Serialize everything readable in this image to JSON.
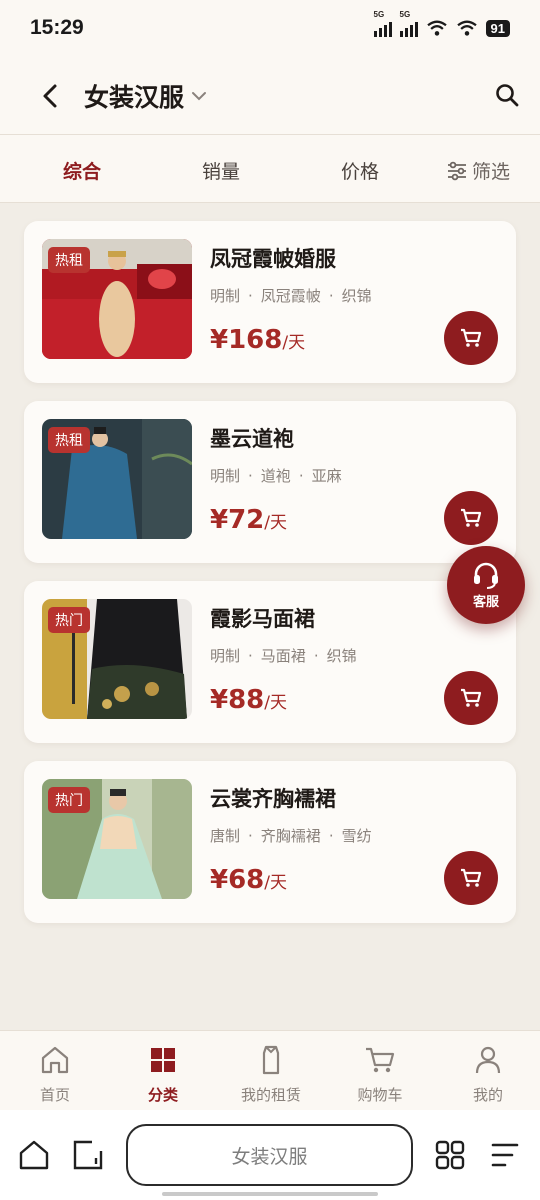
{
  "status_bar": {
    "time": "15:29",
    "signal_labels": [
      "5G",
      "5G"
    ],
    "battery": "91"
  },
  "header": {
    "title": "女装汉服"
  },
  "sort_tabs": [
    {
      "label": "综合",
      "active": true
    },
    {
      "label": "销量",
      "active": false
    },
    {
      "label": "价格",
      "active": false
    },
    {
      "label": "筛选",
      "active": false
    }
  ],
  "products": [
    {
      "name": "凤冠霞帔婚服",
      "badge": "热租",
      "tags": [
        "明制",
        "凤冠霞帔",
        "织锦"
      ],
      "price": "¥168",
      "unit": "/天",
      "image": "red-bridal-dress-photo"
    },
    {
      "name": "墨云道袍",
      "badge": "热租",
      "tags": [
        "明制",
        "道袍",
        "亚麻"
      ],
      "price": "¥72",
      "unit": "/天",
      "image": "blue-taoist-robe-photo"
    },
    {
      "name": "霞影马面裙",
      "badge": "热门",
      "tags": [
        "明制",
        "马面裙",
        "织锦"
      ],
      "price": "¥88",
      "unit": "/天",
      "image": "black-gold-mamian-skirt-photo"
    },
    {
      "name": "云裳齐胸襦裙",
      "badge": "热门",
      "tags": [
        "唐制",
        "齐胸襦裙",
        "雪纺"
      ],
      "price": "¥68",
      "unit": "/天",
      "image": "green-ruqun-dress-photo"
    }
  ],
  "service_fab": {
    "label": "客服"
  },
  "bottom_nav": [
    {
      "label": "首页",
      "icon": "home-icon",
      "active": false
    },
    {
      "label": "分类",
      "icon": "category-grid-icon",
      "active": true
    },
    {
      "label": "我的租赁",
      "icon": "garment-icon",
      "active": false
    },
    {
      "label": "购物车",
      "icon": "cart-icon",
      "active": false
    },
    {
      "label": "我的",
      "icon": "user-icon",
      "active": false
    }
  ],
  "browser_bar": {
    "url_text": "女装汉服"
  },
  "colors": {
    "accent": "#8e1c1f",
    "badge": "#b8332f",
    "price": "#a52a26",
    "background": "#f1ede6",
    "card": "#fdfbf8"
  }
}
